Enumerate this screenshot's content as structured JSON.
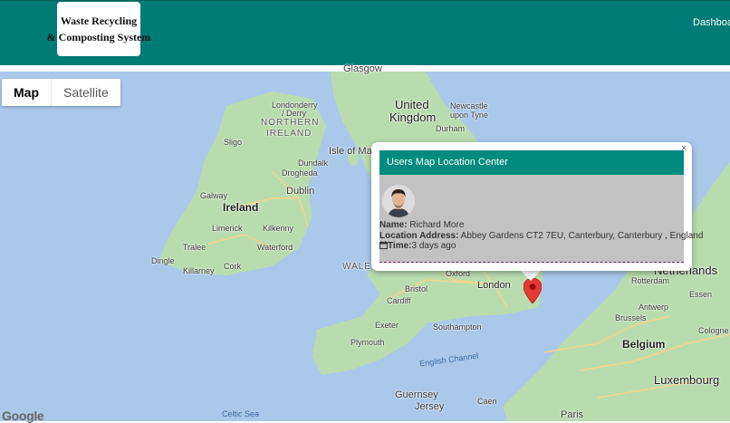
{
  "header": {
    "logo_line1": "Waste Recycling",
    "logo_line2": "& Composting System",
    "nav_dashboard": "Dashboa",
    "header_color": "#007b75"
  },
  "map_type": {
    "map_label": "Map",
    "satellite_label": "Satellite",
    "selected": "Map"
  },
  "map_labels": {
    "glasgow": "Glasgow",
    "united_kingdom_1": "United",
    "united_kingdom_2": "Kingdom",
    "newcastle_1": "Newcastle",
    "newcastle_2": "upon Tyne",
    "durham": "Durham",
    "londonderry_1": "Londonderry",
    "londonderry_2": "/ Derry",
    "northern_1": "NORTHERN",
    "northern_2": "IRELAND",
    "sligo": "Sligo",
    "dundalk": "Dundalk",
    "drogheda": "Drogheda",
    "isle_of_man": "Isle of Ma",
    "galway": "Galway",
    "dublin": "Dublin",
    "ireland": "Ireland",
    "limerick": "Limerick",
    "kilkenny": "Kilkenny",
    "tralee": "Tralee",
    "waterford": "Waterford",
    "dingle": "Dingle",
    "cork": "Cork",
    "killarney": "Killarney",
    "wales": "WALE",
    "oxford": "Oxford",
    "bristol": "Bristol",
    "cardiff": "Cardiff",
    "london": "London",
    "exeter": "Exeter",
    "southampton": "Southampton",
    "plymouth": "Plymouth",
    "english_channel": "English Channel",
    "netherlands": "Netherlands",
    "rotterdam": "Rotterdam",
    "essen": "Essen",
    "antwerp": "Antwerp",
    "brussels": "Brussels",
    "belgium": "Belgium",
    "cologne": "Cologne",
    "luxembourg": "Luxembourg",
    "guernsey": "Guernsey",
    "jersey": "Jersey",
    "caen": "Caen",
    "paris": "Paris",
    "celtic_sea": "Celtic Sea"
  },
  "popup": {
    "title": "Users Map Location Center",
    "close_symbol": "×",
    "name_label": "Name:",
    "name_value": "Richard More",
    "address_label": "Location Address:",
    "address_value": "Abbey Gardens CT2 7EU, Canterbury, Canterbury , England",
    "time_label": "Time:",
    "time_value": "3 days ago",
    "header_color": "#008b7e",
    "time_icon": "calendar-icon"
  },
  "attribution": {
    "google": "Google"
  },
  "marker": {
    "icon": "map-pin-icon",
    "color": "#e53935"
  }
}
